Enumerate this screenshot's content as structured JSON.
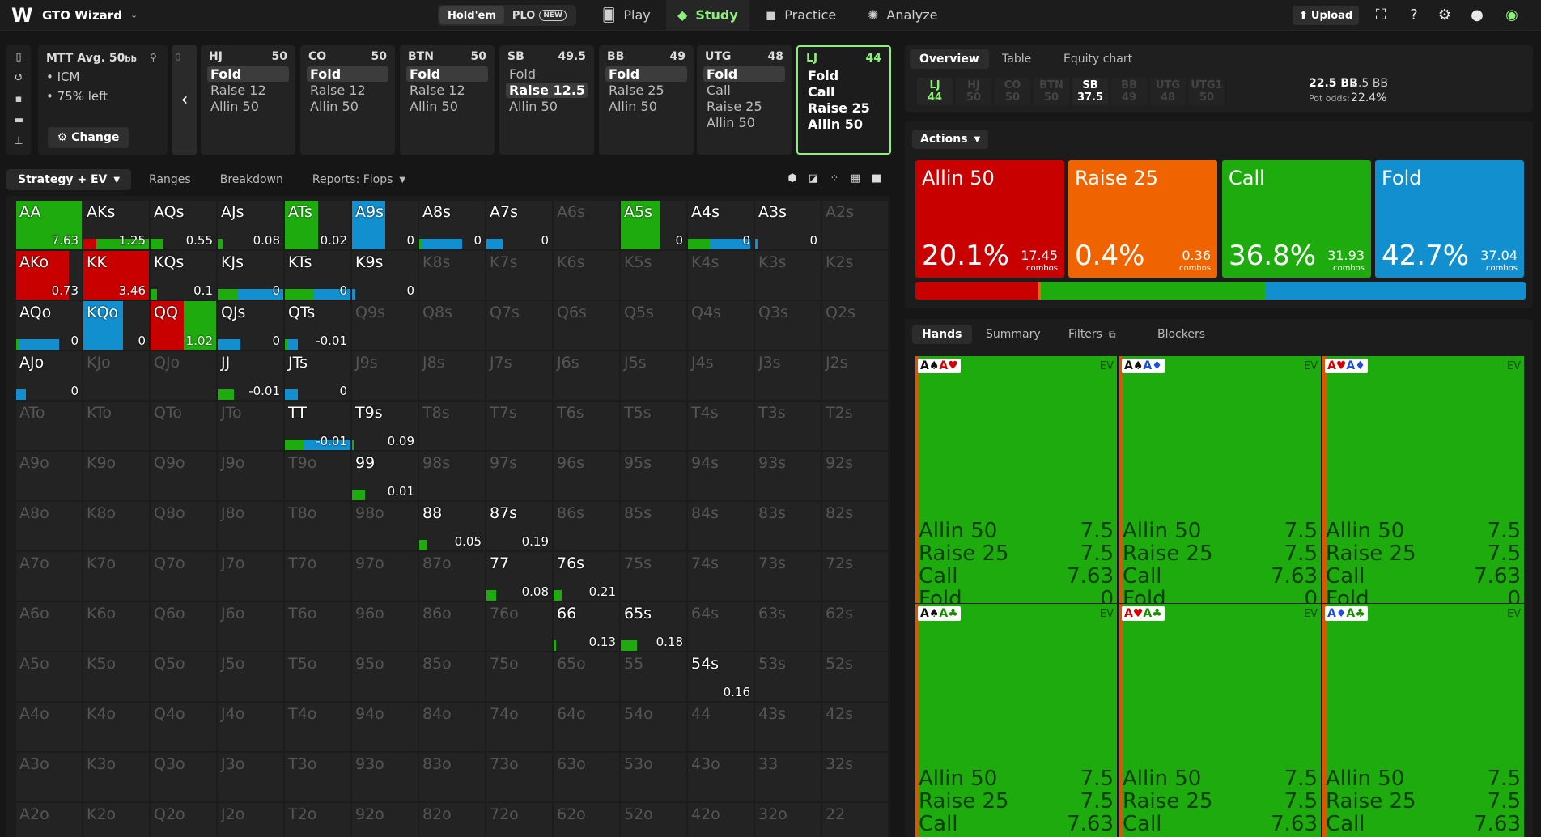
{
  "app": {
    "brand": "GTO Wizard",
    "game_switch": [
      "Hold'em",
      "PLO"
    ],
    "new_badge": "NEW",
    "nav": [
      {
        "label": "Play",
        "icon": "cards-icon"
      },
      {
        "label": "Study",
        "icon": "graduation-cap-icon"
      },
      {
        "label": "Practice",
        "icon": "gamepad-icon"
      },
      {
        "label": "Analyze",
        "icon": "bulb-icon"
      }
    ],
    "upload_label": "Upload"
  },
  "spot": {
    "title": "MTT",
    "avg": "Avg. 50",
    "avg_unit": "bb",
    "bullets": [
      "• ICM",
      "• 75% left"
    ],
    "change_label": "Change",
    "back_ghost": "0"
  },
  "positions": [
    {
      "name": "HJ",
      "stack": "50",
      "actions": [
        "Fold",
        "Raise 12",
        "Allin 50"
      ],
      "selected": 0
    },
    {
      "name": "CO",
      "stack": "50",
      "actions": [
        "Fold",
        "Raise 12",
        "Allin 50"
      ],
      "selected": 0
    },
    {
      "name": "BTN",
      "stack": "50",
      "actions": [
        "Fold",
        "Raise 12",
        "Allin 50"
      ],
      "selected": 0
    },
    {
      "name": "SB",
      "stack": "49.5",
      "actions": [
        "Fold",
        "Raise 12.5",
        "Allin 50"
      ],
      "selected": 1
    },
    {
      "name": "BB",
      "stack": "49",
      "actions": [
        "Fold",
        "Raise 25",
        "Allin 50"
      ],
      "selected": 0
    },
    {
      "name": "UTG",
      "stack": "48",
      "actions": [
        "Fold",
        "Call",
        "Raise 25",
        "Allin 50"
      ],
      "selected": 0
    },
    {
      "name": "LJ",
      "stack": "44",
      "actions": [
        "Fold",
        "Call",
        "Raise 25",
        "Allin 50"
      ],
      "selected": -1
    }
  ],
  "strategy_tabs": [
    "Strategy + EV",
    "Ranges",
    "Breakdown",
    "Reports: Flops"
  ],
  "grid": {
    "ranks": [
      "A",
      "K",
      "Q",
      "J",
      "T",
      "9",
      "8",
      "7",
      "6",
      "5",
      "4",
      "3",
      "2"
    ],
    "cells": {
      "AA": {
        "ev": "7.63",
        "mix": [
          [
            "#1eab0e",
            1
          ]
        ]
      },
      "AKs": {
        "ev": "1.25",
        "mix": [
          [
            "#c80000",
            0.2
          ],
          [
            "#1eab0e",
            0.8
          ]
        ]
      },
      "AQs": {
        "ev": "0.55",
        "mix": [
          [
            "#1eab0e",
            0.2
          ]
        ]
      },
      "AJs": {
        "ev": "0.08",
        "mix": [
          [
            "#1eab0e",
            0.08
          ]
        ]
      },
      "ATs": {
        "ev": "0.02",
        "mix": [
          [
            "#1eab0e",
            0.5
          ]
        ]
      },
      "A9s": {
        "ev": "0",
        "mix": [
          [
            "#128fcf",
            0.5
          ]
        ]
      },
      "A8s": {
        "ev": "0",
        "mix": [
          [
            "#1eab0e",
            0.05
          ],
          [
            "#128fcf",
            0.6
          ]
        ]
      },
      "A7s": {
        "ev": "0",
        "mix": [
          [
            "#128fcf",
            0.25
          ]
        ]
      },
      "A5s": {
        "ev": "0",
        "mix": [
          [
            "#1eab0e",
            0.6
          ]
        ]
      },
      "A4s": {
        "ev": "0",
        "mix": [
          [
            "#1eab0e",
            0.35
          ],
          [
            "#128fcf",
            0.6
          ]
        ]
      },
      "A3s": {
        "ev": "0",
        "mix": [
          [
            "#128fcf",
            0.04
          ]
        ]
      },
      "AKo": {
        "ev": "0.73",
        "mix": [
          [
            "#c80000",
            0.8
          ]
        ]
      },
      "KK": {
        "ev": "3.46",
        "mix": [
          [
            "#c80000",
            1
          ]
        ]
      },
      "KQs": {
        "ev": "0.1",
        "mix": [
          [
            "#1eab0e",
            0.1
          ]
        ]
      },
      "KJs": {
        "ev": "0",
        "mix": [
          [
            "#1eab0e",
            0.3
          ],
          [
            "#128fcf",
            0.7
          ]
        ]
      },
      "KTs": {
        "ev": "0",
        "mix": [
          [
            "#1eab0e",
            0.45
          ],
          [
            "#128fcf",
            0.55
          ]
        ]
      },
      "K9s": {
        "ev": "0",
        "mix": [
          [
            "#128fcf",
            0.05
          ]
        ]
      },
      "AQo": {
        "ev": "0",
        "mix": [
          [
            "#1eab0e",
            0.05
          ],
          [
            "#128fcf",
            0.6
          ]
        ]
      },
      "KQo": {
        "ev": "0",
        "mix": [
          [
            "#128fcf",
            0.6
          ]
        ]
      },
      "QQ": {
        "ev": "1.02",
        "mix": [
          [
            "#c80000",
            0.5
          ],
          [
            "#1eab0e",
            0.5
          ]
        ]
      },
      "QJs": {
        "ev": "0",
        "mix": [
          [
            "#128fcf",
            0.35
          ]
        ]
      },
      "QTs": {
        "ev": "-0.01",
        "mix": [
          [
            "#1eab0e",
            0.05
          ],
          [
            "#128fcf",
            0.15
          ]
        ]
      },
      "AJo": {
        "ev": "0",
        "mix": [
          [
            "#128fcf",
            0.15
          ]
        ]
      },
      "JJ": {
        "ev": "-0.01",
        "mix": [
          [
            "#1eab0e",
            0.25
          ]
        ]
      },
      "JTs": {
        "ev": "0",
        "mix": [
          [
            "#128fcf",
            0.2
          ]
        ]
      },
      "TT": {
        "ev": "-0.01",
        "mix": [
          [
            "#1eab0e",
            0.3
          ],
          [
            "#128fcf",
            0.7
          ]
        ]
      },
      "T9s": {
        "ev": "0.09",
        "mix": [
          [
            "#1eab0e",
            0.03
          ]
        ]
      },
      "99": {
        "ev": "0.01",
        "mix": [
          [
            "#1eab0e",
            0.2
          ]
        ]
      },
      "88": {
        "ev": "0.05",
        "mix": [
          [
            "#1eab0e",
            0.12
          ]
        ]
      },
      "87s": {
        "ev": "0.19",
        "mix": []
      },
      "77": {
        "ev": "0.08",
        "mix": [
          [
            "#1eab0e",
            0.15
          ]
        ]
      },
      "76s": {
        "ev": "0.21",
        "mix": [
          [
            "#1eab0e",
            0.12
          ]
        ]
      },
      "66": {
        "ev": "0.13",
        "mix": [
          [
            "#1eab0e",
            0.04
          ]
        ]
      },
      "65s": {
        "ev": "0.18",
        "mix": [
          [
            "#1eab0e",
            0.25
          ]
        ]
      },
      "54s": {
        "ev": "0.16",
        "mix": []
      }
    }
  },
  "overview": {
    "tabs": [
      "Overview",
      "Table",
      "Equity chart"
    ],
    "chips": [
      {
        "pos": "LJ",
        "stack": "44"
      },
      {
        "pos": "HJ",
        "stack": "50"
      },
      {
        "pos": "CO",
        "stack": "50"
      },
      {
        "pos": "BTN",
        "stack": "50"
      },
      {
        "pos": "SB",
        "stack": "37.5"
      },
      {
        "pos": "BB",
        "stack": "49"
      },
      {
        "pos": "UTG",
        "stack": "48"
      },
      {
        "pos": "UTG1",
        "stack": "50"
      }
    ],
    "pot": "22.5 BB",
    "to_call": "2.5 BB",
    "pot_odds_label": "Pot odds:",
    "pot_odds": "22.4%"
  },
  "actions": {
    "header": "Actions",
    "items": [
      {
        "name": "Allin 50",
        "pct": "20.1%",
        "combos": "17.45",
        "color": "#c80000",
        "freq": 20.1
      },
      {
        "name": "Raise 25",
        "pct": "0.4%",
        "combos": "0.36",
        "color": "#f06400",
        "freq": 0.4
      },
      {
        "name": "Call",
        "pct": "36.8%",
        "combos": "31.93",
        "color": "#1eab0e",
        "freq": 36.8
      },
      {
        "name": "Fold",
        "pct": "42.7%",
        "combos": "37.04",
        "color": "#128fcf",
        "freq": 42.7
      }
    ],
    "combos_label": "combos"
  },
  "hands": {
    "tabs": [
      "Hands",
      "Summary",
      "Filters",
      "Blockers"
    ],
    "ev_label": "EV",
    "cards": [
      {
        "combo": [
          [
            "A",
            "♠",
            "blk"
          ],
          [
            "A",
            "♥",
            "red"
          ]
        ]
      },
      {
        "combo": [
          [
            "A",
            "♠",
            "blk"
          ],
          [
            "A",
            "♦",
            "blue"
          ]
        ]
      },
      {
        "combo": [
          [
            "A",
            "♥",
            "red"
          ],
          [
            "A",
            "♦",
            "blue"
          ]
        ]
      },
      {
        "combo": [
          [
            "A",
            "♠",
            "blk"
          ],
          [
            "A",
            "♣",
            "green"
          ]
        ]
      },
      {
        "combo": [
          [
            "A",
            "♥",
            "red"
          ],
          [
            "A",
            "♣",
            "green"
          ]
        ]
      },
      {
        "combo": [
          [
            "A",
            "♦",
            "blue"
          ],
          [
            "A",
            "♣",
            "green"
          ]
        ]
      }
    ],
    "rows": [
      {
        "label": "Allin 50",
        "value": "7.5"
      },
      {
        "label": "Raise 25",
        "value": "7.5"
      },
      {
        "label": "Call",
        "value": "7.63"
      },
      {
        "label": "Fold",
        "value": "0"
      }
    ]
  }
}
